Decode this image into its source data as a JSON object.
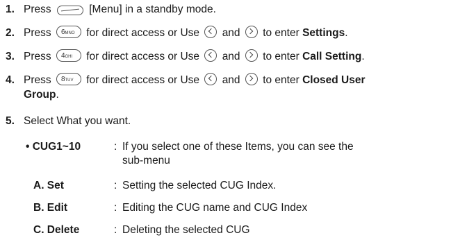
{
  "steps": [
    {
      "num": "1.",
      "pre": "Press",
      "post": "[Menu] in a standby mode."
    },
    {
      "num": "2.",
      "pre": "Press",
      "key": "6",
      "keysub": "MNO",
      "mid": "for direct access or Use",
      "and": "and",
      "to": "to enter",
      "target": "Settings",
      "end": "."
    },
    {
      "num": "3.",
      "pre": "Press",
      "key": "4",
      "keysub": "GHI",
      "mid": "for direct access or Use",
      "and": "and",
      "to": "to enter",
      "target": "Call Setting",
      "end": "."
    },
    {
      "num": "4.",
      "pre": "Press",
      "key": "8",
      "keysub": "TUV",
      "mid": "for direct access or Use",
      "and": "and",
      "to": "to enter",
      "target": "Closed User",
      "target2": "Group",
      "end": "."
    },
    {
      "num": "5.",
      "text": "Select What you want."
    }
  ],
  "items": [
    {
      "term": "• CUG1~10",
      "sep": ":",
      "desc": "If you select one of these Items, you can see the",
      "desc2": "sub-menu"
    },
    {
      "term": "A. Set",
      "sep": ":",
      "desc": "Setting the selected CUG Index."
    },
    {
      "term": "B. Edit",
      "sep": ":",
      "desc": "Editing the CUG name and CUG Index"
    },
    {
      "term": "C. Delete",
      "sep": ":",
      "desc": "Deleting the selected CUG"
    }
  ]
}
